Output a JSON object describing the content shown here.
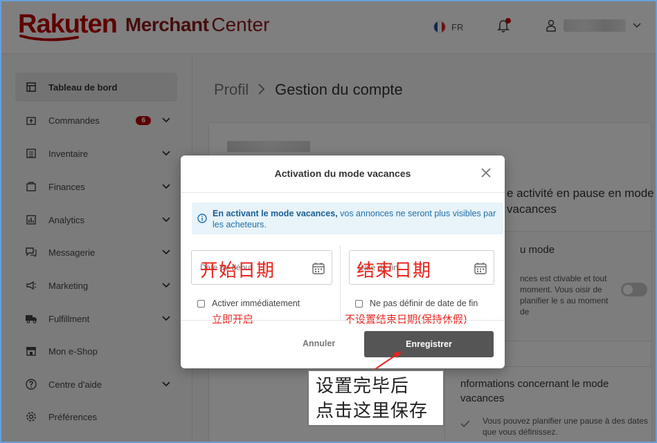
{
  "header": {
    "logo_brand": "Rakuten",
    "logo_merchant": "Merchant",
    "logo_center": "Center",
    "lang_code": "FR",
    "brand_color": "#bf0000"
  },
  "sidebar": {
    "items": [
      {
        "label": "Tableau de bord",
        "icon": "dashboard-icon",
        "active": true
      },
      {
        "label": "Commandes",
        "icon": "orders-icon",
        "badge": "6"
      },
      {
        "label": "Inventaire",
        "icon": "inventory-icon"
      },
      {
        "label": "Finances",
        "icon": "finances-icon"
      },
      {
        "label": "Analytics",
        "icon": "analytics-icon"
      },
      {
        "label": "Messagerie",
        "icon": "messaging-icon"
      },
      {
        "label": "Marketing",
        "icon": "megaphone-icon"
      },
      {
        "label": "Fulfillment",
        "icon": "truck-icon"
      },
      {
        "label": "Mon e-Shop",
        "icon": "shop-icon"
      },
      {
        "label": "Centre d'aide",
        "icon": "help-icon"
      },
      {
        "label": "Préférences",
        "icon": "gear-icon"
      }
    ]
  },
  "main": {
    "breadcrumb_parent": "Profil",
    "breadcrumb_current": "Gestion du compte",
    "bg_section_title": "e activité en pause en mode vacances",
    "bg_panel_title": "u mode",
    "bg_panel_text": "nces est ctivable et tout moment. Vous oisir de planifier le s au moment de",
    "bg_panel2_title": "nformations concernant le mode vacances",
    "bg_panel2_text": "Vous pouvez planifier une pause à des dates que vous définissez."
  },
  "modal": {
    "title": "Activation du mode vacances",
    "info_bold": "En activant le mode vacances,",
    "info_rest": " vos annonces ne seront plus visibles par les acheteurs.",
    "start_placeholder": "Date de début",
    "end_placeholder": "Date de fin",
    "check_immediate": "Activer immédiatement",
    "check_no_end": "Ne pas définir de date de fin",
    "cancel_label": "Annuler",
    "save_label": "Enregistrer"
  },
  "annotations": {
    "start_date": "开始日期",
    "end_date": "结束日期",
    "immediate": "立即开启",
    "no_end": "不设置结束日期(保持休假)",
    "callout_line1": "设置完毕后",
    "callout_line2": "点击这里保存",
    "color": "#e8251e"
  }
}
